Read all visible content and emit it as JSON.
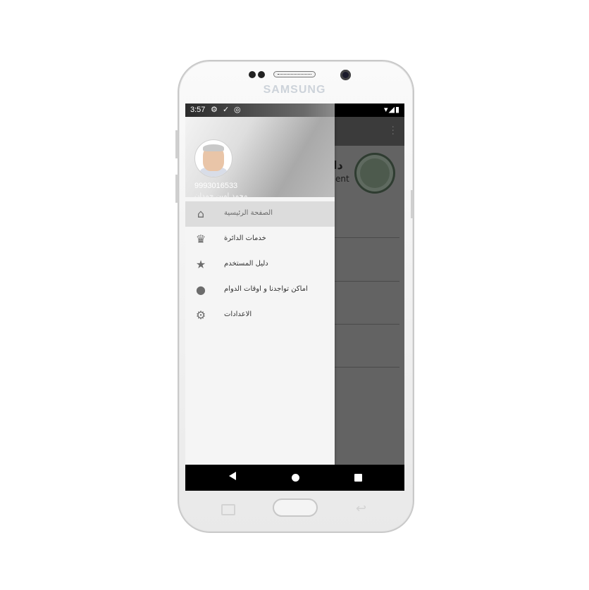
{
  "device": {
    "brand": "SAMSUNG"
  },
  "status_bar": {
    "time": "3:57",
    "left_icons": [
      "gear-icon",
      "download-done-icon",
      "data-saver-icon"
    ],
    "right_icons": [
      "wifi-icon",
      "signal-icon",
      "battery-icon"
    ]
  },
  "app": {
    "title_ar": "دا",
    "title_en": "ent",
    "overflow_icon": "more-vert-icon"
  },
  "drawer": {
    "header": {
      "phone": "9993016533",
      "name": "محمد امين حمدان"
    },
    "items": [
      {
        "label": "الصفحة الرئيسية",
        "icon": "home-icon",
        "active": true
      },
      {
        "label": "خدمات الدائرة",
        "icon": "crown-icon",
        "active": false
      },
      {
        "label": "دليل المستخدم",
        "icon": "star-icon",
        "active": false
      },
      {
        "label": "اماكن تواجدنا و اوقات الدوام",
        "icon": "globe-icon",
        "active": false
      },
      {
        "label": "الاعدادات",
        "icon": "settings-icon",
        "active": false
      }
    ]
  },
  "nav_bar": {
    "buttons": [
      "back-icon",
      "home-icon",
      "recents-icon"
    ]
  },
  "colors": {
    "drawer_bg": "#f5f5f5",
    "active_item": "#dcdcdc",
    "scrim": "#636363"
  }
}
